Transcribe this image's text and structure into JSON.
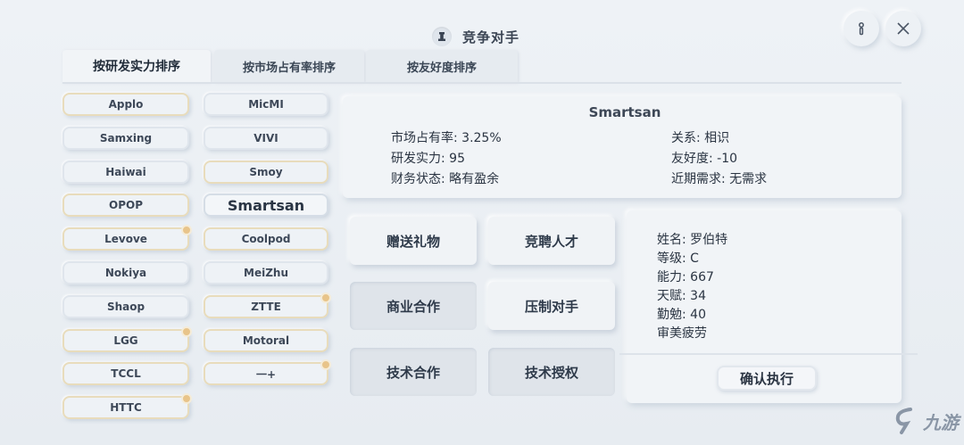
{
  "header": {
    "title": "竞争对手",
    "title_icon": "pawn-icon",
    "help_icon": "info-icon",
    "close_icon": "close-icon"
  },
  "tabs": [
    {
      "label": "按研发实力排序",
      "active": true
    },
    {
      "label": "按市场占有率排序",
      "active": false
    },
    {
      "label": "按友好度排序",
      "active": false
    }
  ],
  "companies": {
    "col1": [
      {
        "name": "Applo",
        "gold": true,
        "dot": false
      },
      {
        "name": "Samxing",
        "gold": false,
        "dot": false
      },
      {
        "name": "Haiwai",
        "gold": false,
        "dot": false
      },
      {
        "name": "OPOP",
        "gold": true,
        "dot": false
      },
      {
        "name": "Levove",
        "gold": true,
        "dot": true
      },
      {
        "name": "Nokiya",
        "gold": false,
        "dot": false
      },
      {
        "name": "Shaop",
        "gold": false,
        "dot": false
      },
      {
        "name": "LGG",
        "gold": true,
        "dot": true
      },
      {
        "name": "TCCL",
        "gold": true,
        "dot": false
      },
      {
        "name": "HTTC",
        "gold": true,
        "dot": true
      }
    ],
    "col2": [
      {
        "name": "MicMI",
        "gold": false,
        "dot": false
      },
      {
        "name": "VIVI",
        "gold": false,
        "dot": false
      },
      {
        "name": "Smoy",
        "gold": true,
        "dot": false
      },
      {
        "name": "Smartsan",
        "gold": false,
        "dot": false,
        "selected": true
      },
      {
        "name": "Coolpod",
        "gold": true,
        "dot": false
      },
      {
        "name": "MeiZhu",
        "gold": false,
        "dot": false
      },
      {
        "name": "ZTTE",
        "gold": true,
        "dot": true
      },
      {
        "name": "Motoral",
        "gold": true,
        "dot": false
      },
      {
        "name": "一+",
        "gold": true,
        "dot": true
      }
    ]
  },
  "company_info": {
    "name": "Smartsan",
    "market_share": "市场占有率: 3.25%",
    "rd_power": "研发实力: 95",
    "finance": "财务状态: 略有盈余",
    "relation": "关系: 相识",
    "friendliness": "友好度: -10",
    "demand": "近期需求: 无需求"
  },
  "actions": {
    "gift": "赠送礼物",
    "recruit": "竞聘人才",
    "biz_coop": "商业合作",
    "suppress": "压制对手",
    "tech_coop": "技术合作",
    "tech_license": "技术授权"
  },
  "person": {
    "name": "姓名: 罗伯特",
    "level": "等级: C",
    "ability": "能力: 667",
    "talent": "天赋: 34",
    "diligence": "勤勉: 40",
    "trait": "审美疲劳"
  },
  "confirm_label": "确认执行",
  "watermark": "九游"
}
